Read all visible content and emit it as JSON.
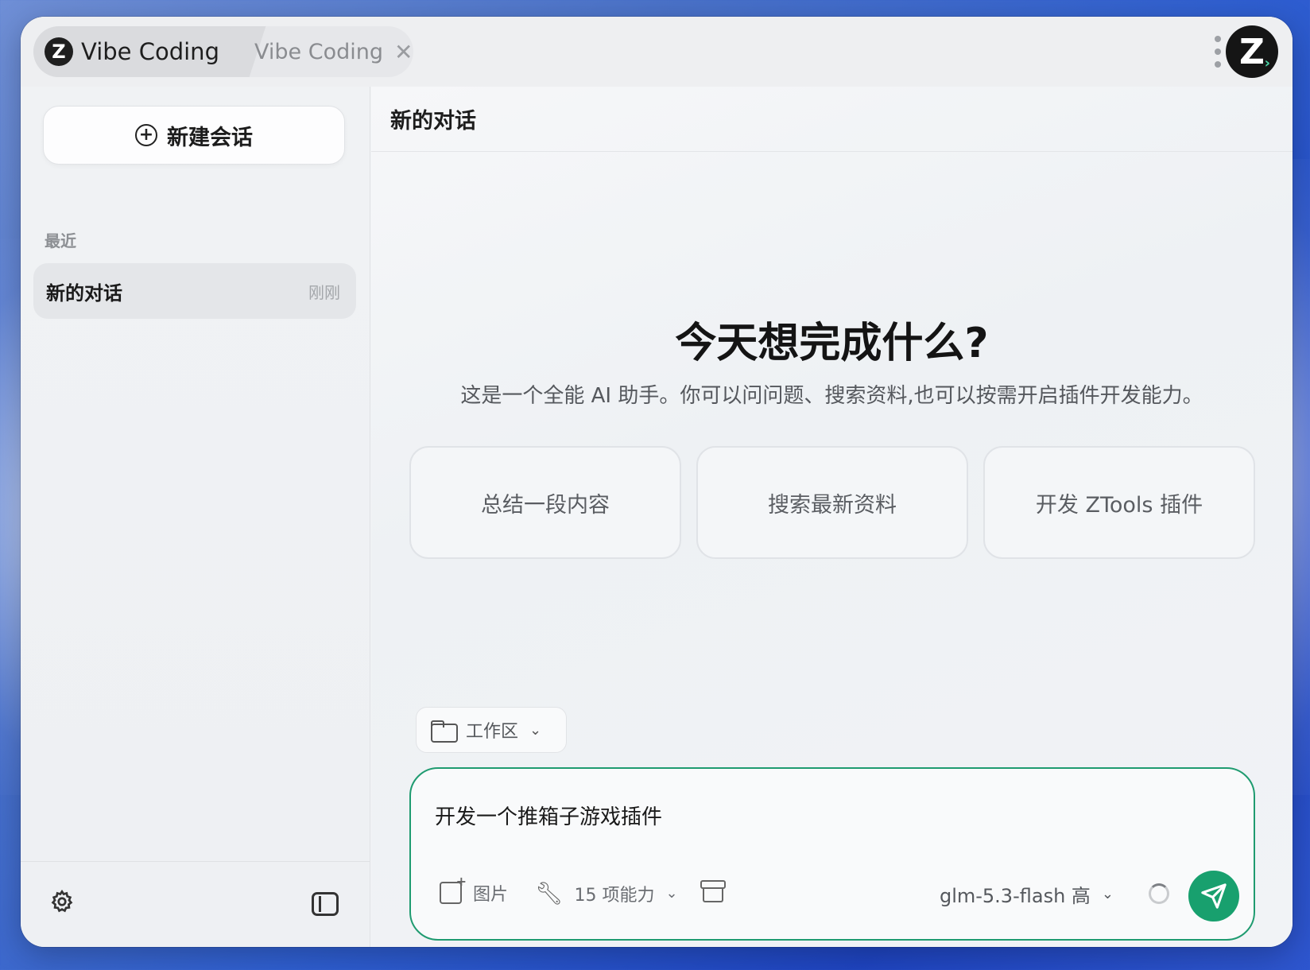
{
  "titlebar": {
    "active_tab": "Vibe Coding",
    "inactive_tab": "Vibe Coding",
    "close_glyph": "✕",
    "logo_letter": "Z"
  },
  "sidebar": {
    "new_chat_label": "新建会话",
    "recent_label": "最近",
    "conversations": [
      {
        "title": "新的对话",
        "time": "刚刚"
      }
    ]
  },
  "main": {
    "header_title": "新的对话",
    "hero_title": "今天想完成什么?",
    "hero_subtitle": "这是一个全能 AI 助手。你可以问问题、搜索资料,也可以按需开启插件开发能力。",
    "suggestions": [
      "总结一段内容",
      "搜索最新资料",
      "开发 ZTools 插件"
    ],
    "workspace_label": "工作区",
    "composer": {
      "value": "开发一个推箱子游戏插件",
      "image_label": "图片",
      "abilities_label": "15 项能力",
      "model_label": "glm-5.3-flash 高"
    }
  },
  "colors": {
    "accent": "#18a06e",
    "composer_border": "#1f9b70"
  },
  "icons": [
    "logo-icon",
    "close-icon",
    "more-icon",
    "avatar-icon",
    "plus-circle-icon",
    "gear-icon",
    "sidebar-toggle-icon",
    "folder-icon",
    "chevron-down-icon",
    "image-add-icon",
    "wrench-icon",
    "archive-icon",
    "spinner-icon",
    "send-icon"
  ]
}
